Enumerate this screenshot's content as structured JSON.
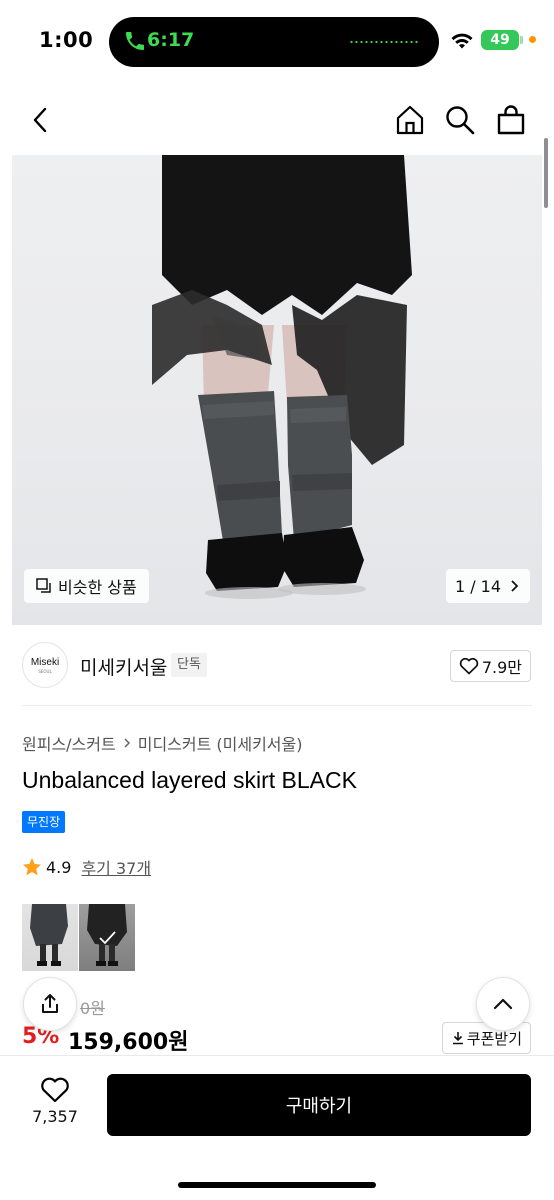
{
  "status_bar": {
    "time": "1:00",
    "island_time": "6:17",
    "battery": "49",
    "colors": {
      "island_accent": "#3ddc50",
      "battery": "#34c759",
      "indicator_dot": "#ff9500"
    }
  },
  "nav": {
    "back_icon": "chevron-left-icon",
    "home_icon": "home-icon",
    "search_icon": "search-icon",
    "bag_icon": "shopping-bag-icon"
  },
  "hero": {
    "similar_label": "비슷한 상품",
    "pager_text": "1 / 14"
  },
  "brand": {
    "logo_text": "Miseki",
    "logo_sub": "SEOUL",
    "name": "미세키서울",
    "tag": "단독",
    "likes": "7.9만"
  },
  "product": {
    "breadcrumb": [
      "원피스/스커트",
      "미디스커트 (미세키서울)"
    ],
    "title": "Unbalanced layered skirt BLACK",
    "badge": "무진장",
    "rating": "4.9",
    "review_link": "후기 37개",
    "original_price": "0원",
    "discount": "5%",
    "price": "159,600원",
    "coupon_label": "쿠폰받기"
  },
  "bottom": {
    "wish_count": "7,357",
    "buy_label": "구매하기"
  }
}
